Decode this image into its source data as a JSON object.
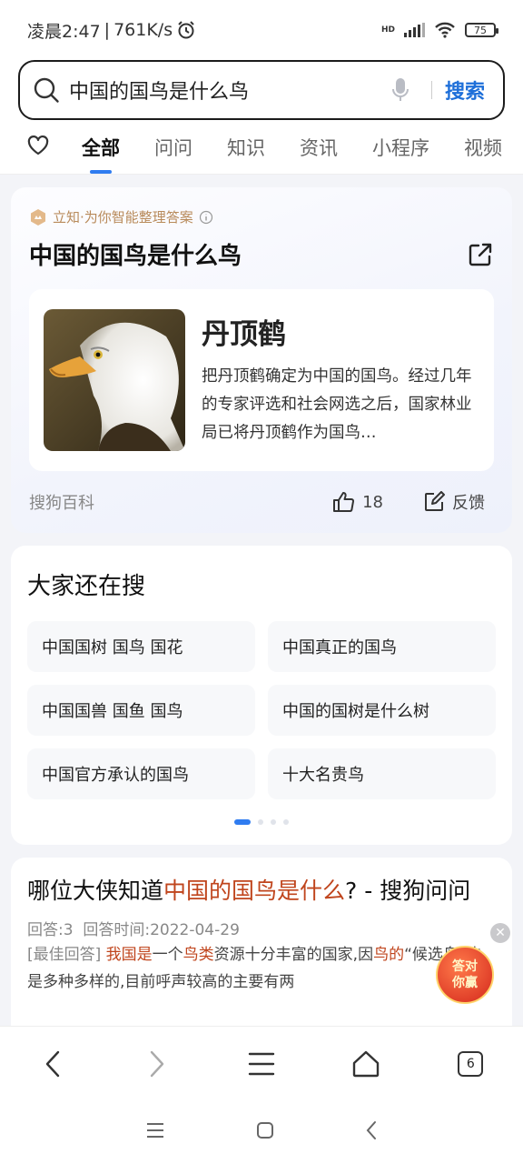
{
  "status": {
    "time": "凌晨2:47",
    "speed": "761K/s",
    "network": "HD",
    "battery": "75"
  },
  "search": {
    "query": "中国的国鸟是什么鸟",
    "button": "搜索"
  },
  "tabs": [
    "全部",
    "问问",
    "知识",
    "资讯",
    "小程序",
    "视频"
  ],
  "answer": {
    "badge": "立知·为你智能整理答案",
    "title": "中国的国鸟是什么鸟",
    "name": "丹顶鹤",
    "desc": "把丹顶鹤确定为中国的国鸟。经过几年的专家评选和社会网选之后，国家林业局已将丹顶鹤作为国鸟…",
    "source": "搜狗百科",
    "likes": "18",
    "feedback": "反馈"
  },
  "related": {
    "title": "大家还在搜",
    "items": [
      "中国国树 国鸟 国花",
      "中国真正的国鸟",
      "中国国兽 国鱼 国鸟",
      "中国的国树是什么树",
      "中国官方承认的国鸟",
      "十大名贵鸟"
    ]
  },
  "result": {
    "title_prefix": "哪位大侠知道",
    "title_highlight": "中国的国鸟是什么",
    "title_suffix": "? - 搜狗问问",
    "meta_answers": "回答:3",
    "meta_time": "回答时间:2022-04-29",
    "snippet_tag": "[最佳回答]",
    "snippet_hl1": "我国是",
    "snippet_t1": "一个",
    "snippet_hl2": "鸟类",
    "snippet_t2": "资源十分丰富的国家,因",
    "snippet_hl3": "鸟的",
    "snippet_t3": "“候选鸟”也是多种多样的,目前呼声较高的主要有两"
  },
  "promo": {
    "line1": "答对",
    "line2": "你赢"
  },
  "bottom_nav": {
    "tab_count": "6"
  },
  "colors": {
    "accent": "#2f7cf0",
    "highlight": "#c0451d",
    "search_btn": "#1e6fd9"
  }
}
